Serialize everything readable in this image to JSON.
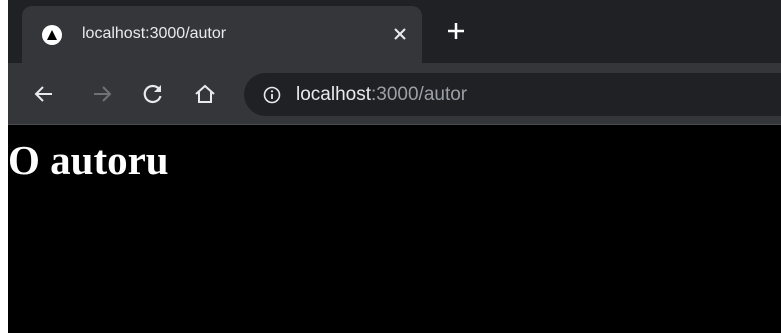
{
  "tab": {
    "title": "localhost:3000/autor",
    "favicon_icon": "triangle-logo-icon",
    "close_icon": "close-icon"
  },
  "tabstrip": {
    "new_tab_icon": "plus-icon"
  },
  "toolbar": {
    "back_icon": "arrow-left-icon",
    "forward_icon": "arrow-right-icon",
    "reload_icon": "reload-icon",
    "home_icon": "home-icon"
  },
  "address_bar": {
    "info_icon": "info-icon",
    "host": "localhost",
    "rest": ":3000/autor"
  },
  "page": {
    "heading": "O autoru"
  },
  "colors": {
    "tabstrip_bg": "#202124",
    "active_tab_bg": "#35363a",
    "omnibox_bg": "#202124",
    "page_bg": "#000000",
    "text_primary": "#e8eaed",
    "text_muted": "#9aa0a6",
    "heading_color": "#ffffff"
  }
}
